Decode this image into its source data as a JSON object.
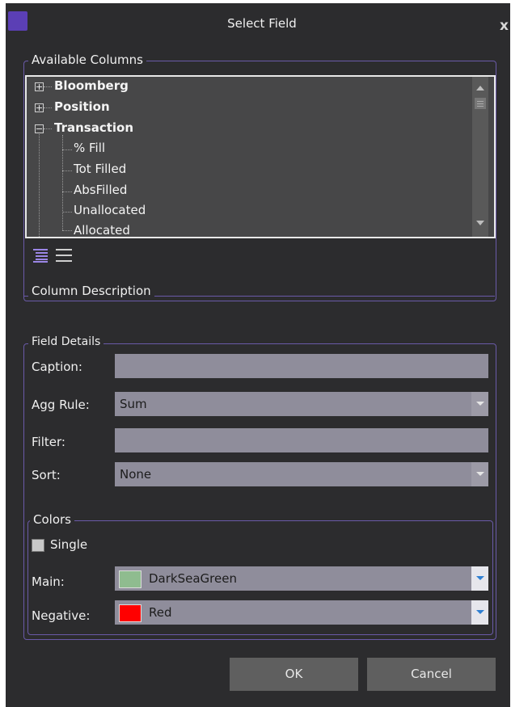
{
  "window": {
    "title": "Select Field",
    "close_symbol": "x"
  },
  "available_columns": {
    "legend": "Available Columns",
    "tree": [
      {
        "label": "Bloomberg",
        "expander": "+"
      },
      {
        "label": "Position",
        "expander": "+"
      },
      {
        "label": "Transaction",
        "expander": "-",
        "children": [
          "% Fill",
          "Tot Filled",
          "AbsFilled",
          "Unallocated",
          "Allocated"
        ]
      }
    ],
    "toolbar": [
      "list-indent-icon",
      "list-flat-icon"
    ],
    "description_legend": "Column Description"
  },
  "field_details": {
    "legend": "Field Details",
    "caption": {
      "label": "Caption:",
      "value": ""
    },
    "agg_rule": {
      "label": "Agg Rule:",
      "value": "Sum"
    },
    "filter": {
      "label": "Filter:",
      "value": ""
    },
    "sort": {
      "label": "Sort:",
      "value": "None"
    }
  },
  "colors": {
    "legend": "Colors",
    "single": {
      "label": "Single",
      "checked": false
    },
    "main": {
      "label": "Main:",
      "value": "DarkSeaGreen",
      "swatch": "#8fbc8f"
    },
    "negative": {
      "label": "Negative:",
      "value": "Red",
      "swatch": "#ff0000"
    }
  },
  "buttons": {
    "ok": "OK",
    "cancel": "Cancel"
  },
  "theme": {
    "accent": "#6a5aa8",
    "window_bg": "#2c2c2e",
    "field_bg": "#8f8d9b"
  }
}
